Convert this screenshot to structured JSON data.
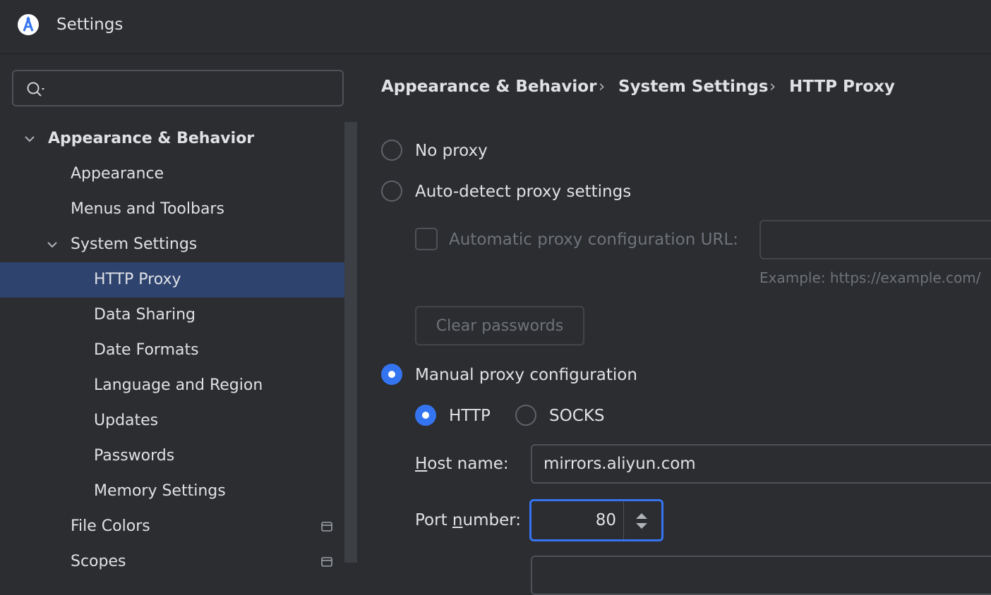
{
  "window": {
    "title": "Settings"
  },
  "search": {
    "placeholder": ""
  },
  "sidebar": {
    "items": [
      {
        "label": "Appearance & Behavior"
      },
      {
        "label": "Appearance"
      },
      {
        "label": "Menus and Toolbars"
      },
      {
        "label": "System Settings"
      },
      {
        "label": "HTTP Proxy"
      },
      {
        "label": "Data Sharing"
      },
      {
        "label": "Date Formats"
      },
      {
        "label": "Language and Region"
      },
      {
        "label": "Updates"
      },
      {
        "label": "Passwords"
      },
      {
        "label": "Memory Settings"
      },
      {
        "label": "File Colors"
      },
      {
        "label": "Scopes"
      }
    ]
  },
  "breadcrumb": {
    "items": [
      "Appearance & Behavior",
      "System Settings",
      "HTTP Proxy"
    ],
    "separator": "›"
  },
  "proxy": {
    "no_proxy": "No proxy",
    "auto_detect": "Auto-detect proxy settings",
    "auto_config_url_label": "Automatic proxy configuration URL:",
    "auto_config_url_value": "",
    "example": "Example: https://example.com/",
    "clear_passwords": "Clear passwords",
    "manual": "Manual proxy configuration",
    "http": "HTTP",
    "socks": "SOCKS",
    "host_label_mnemonic": "H",
    "host_label_rest": "ost name:",
    "host_value": "mirrors.aliyun.com",
    "port_label_pre": "Port ",
    "port_label_mnemonic": "n",
    "port_label_post": "umber:",
    "port_value": "80"
  },
  "colors": {
    "accent": "#3574f0",
    "selection": "#2e436e",
    "background": "#2b2d30"
  }
}
